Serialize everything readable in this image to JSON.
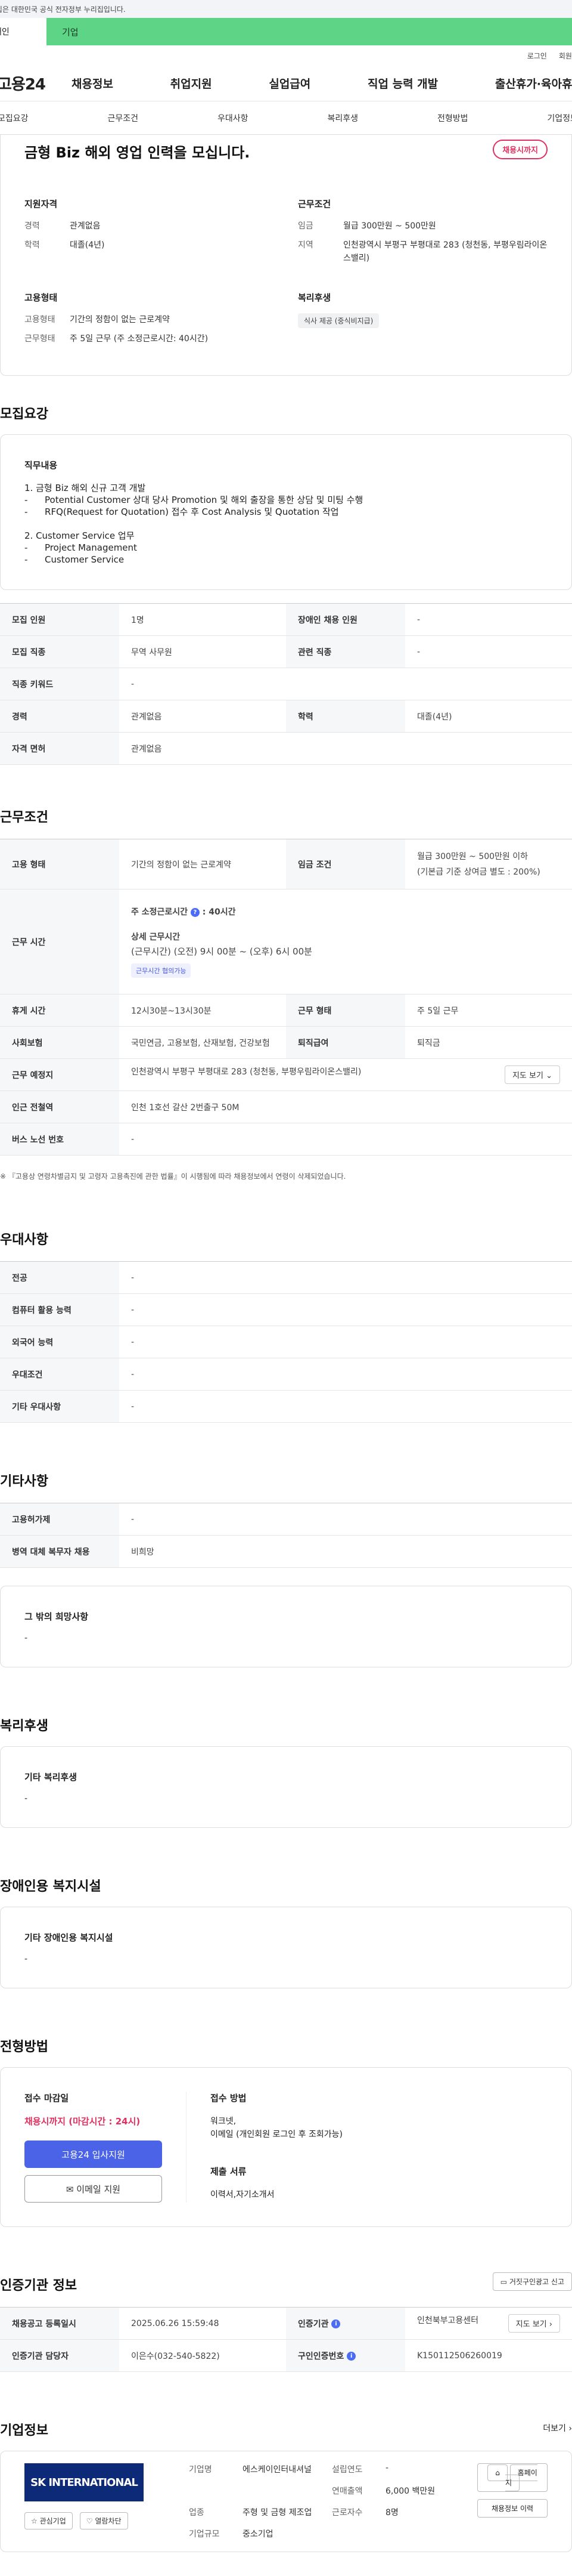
{
  "gov_banner": "이 누리집은 대한민국 공식 전자정부 누리집입니다.",
  "tabs": {
    "personal": "개인",
    "corporate": "기업"
  },
  "util": {
    "login": "로그인",
    "join": "회원가입"
  },
  "logo": "고용24",
  "gnb": [
    "채용정보",
    "취업지원",
    "실업급여",
    "직업 능력 개발",
    "출산휴가·육아휴직"
  ],
  "snb": [
    "모집요강",
    "근무조건",
    "우대사항",
    "복리후생",
    "전형방법",
    "기업정보"
  ],
  "summary": {
    "title": "금형 Biz 해외 영업 인력을 모십니다.",
    "badge": "채용시까지",
    "qual_head": "지원자격",
    "career_k": "경력",
    "career_v": "관계없음",
    "edu_k": "학력",
    "edu_v": "대졸(4년)",
    "cond_head": "근무조건",
    "wage_k": "임금",
    "wage_v": "월급 300만원 ~ 500만원",
    "loc_k": "지역",
    "loc_v": "인천광역시 부평구 부평대로 283 (청천동, 부평우림라이온스밸리)",
    "emp_head": "고용형태",
    "emptype_k": "고용형태",
    "emptype_v": "기간의 정함이 없는 근로계약",
    "worktype_k": "근무형태",
    "worktype_v": "주 5일 근무 (주 소정근로시간: 40시간)",
    "welfare_head": "복리후생",
    "welfare_chip": "식사 제공 (중식비지급)"
  },
  "recruit": {
    "heading": "모집요강",
    "duty_label": "직무내용",
    "duty_text": "1. 금형 Biz 해외 신규 고객 개발\n-      Potential Customer 상대 당사 Promotion 및 해외 출장을 통한 상담 및 미팅 수행\n-      RFQ(Request for Quotation) 접수 후 Cost Analysis 및 Quotation 작업\n\n2. Customer Service 업무\n-      Project Management\n-      Customer Service",
    "rows": {
      "count_k": "모집 인원",
      "count_v": "1명",
      "disabled_k": "장애인 채용 인원",
      "disabled_v": "-",
      "job_k": "모집 직종",
      "job_v": "무역 사무원",
      "rel_k": "관련 직종",
      "rel_v": "-",
      "kw_k": "직종 키워드",
      "kw_v": "-",
      "career_k": "경력",
      "career_v": "관계없음",
      "edu_k": "학력",
      "edu_v": "대졸(4년)",
      "lic_k": "자격 면허",
      "lic_v": "관계없음"
    }
  },
  "work": {
    "heading": "근무조건",
    "emptype_k": "고용 형태",
    "emptype_v": "기간의 정함이 없는 근로계약",
    "wage_k": "임금 조건",
    "wage_v1": "월급 300만원 ~ 500만원 이하",
    "wage_v2": "(기본급 기준 상여금 별도 : 200%)",
    "hours_k": "근무 시간",
    "hours_weekly": "주 소정근로시간",
    "hours_weekly_v": ": 40시간",
    "hours_detail_label": "상세 근무시간",
    "hours_detail": "(근무시간) (오전) 9시 00분 ~ (오후) 6시 00분",
    "hours_chip": "근무시간 협의가능",
    "break_k": "휴게 시간",
    "break_v": "12시30분~13시30분",
    "form_k": "근무 형태",
    "form_v": "주 5일 근무",
    "ins_k": "사회보험",
    "ins_v": "국민연금, 고용보험, 산재보험, 건강보험",
    "sev_k": "퇴직급여",
    "sev_v": "퇴직금",
    "place_k": "근무 예정지",
    "place_v": "인천광역시 부평구 부평대로 283 (청천동, 부평우림라이온스밸리)",
    "map_btn": "지도 보기",
    "subway_k": "인근 전철역",
    "subway_v": "인천 1호선 갈산 2번출구 50M",
    "bus_k": "버스 노선 번호",
    "bus_v": "-",
    "note": "※ 『고용상 연령차별금지 및 고령자 고용촉진에 관한 법률』이 시행됨에 따라 채용정보에서 연령이 삭제되었습니다."
  },
  "pref": {
    "heading": "우대사항",
    "major_k": "전공",
    "major_v": "-",
    "pc_k": "컴퓨터 활용 능력",
    "pc_v": "-",
    "lang_k": "외국어 능력",
    "lang_v": "-",
    "cond_k": "우대조건",
    "cond_v": "-",
    "etc_k": "기타 우대사항",
    "etc_v": "-"
  },
  "etc": {
    "heading": "기타사항",
    "permit_k": "고용허가제",
    "permit_v": "-",
    "army_k": "병역 대체 복무자 채용",
    "army_v": "비희망",
    "hope_label": "그 밖의 희망사항",
    "hope_v": "-"
  },
  "welfare": {
    "heading": "복리후생",
    "label": "기타 복리후생",
    "v": "-"
  },
  "disabled": {
    "heading": "장애인용 복지시설",
    "label": "기타 장애인용 복지시설",
    "v": "-"
  },
  "apply": {
    "heading": "전형방법",
    "deadline_label": "접수 마감일",
    "deadline_v": "채용시까지 (마감시간 : 24시)",
    "apply_btn": "고용24 입사지원",
    "email_btn": "이메일 지원",
    "method_label": "접수 방법",
    "method_v1": "워크넷,",
    "method_v2": "이메일 (개인회원 로그인 후 조회가능)",
    "docs_label": "제출 서류",
    "docs_v": "이력서,자기소개서"
  },
  "cert": {
    "heading": "인증기관 정보",
    "report_btn": "거짓구인광고 신고",
    "reg_k": "채용공고 등록일시",
    "reg_v": "2025.06.26 15:59:48",
    "org_k": "인증기관",
    "org_v": "인천북부고용센터",
    "map_btn": "지도 보기",
    "mgr_k": "인증기관 담당자",
    "mgr_v": "이은수(032-540-5822)",
    "no_k": "구인인증번호",
    "no_v": "K150112506260019"
  },
  "company": {
    "heading": "기업정보",
    "more": "더보기",
    "logo_text": "SK INTERNATIONAL",
    "interest_btn": "관심기업",
    "block_btn": "열람차단",
    "name_k": "기업명",
    "name_v": "에스케이인터내셔널",
    "founded_k": "설립연도",
    "founded_v": "-",
    "sales_k": "연매출액",
    "sales_v": "6,000 백만원",
    "ind_k": "업종",
    "ind_v": "주형 및 금형 제조업",
    "emp_k": "근로자수",
    "emp_v": "8명",
    "size_k": "기업규모",
    "size_v": "중소기업",
    "home_btn": "홈페이지",
    "jobs_btn": "채용정보 이력"
  },
  "colors": {
    "accent": "#4a63e7",
    "badge": "#e03060",
    "tab_green": "#5dd486"
  }
}
